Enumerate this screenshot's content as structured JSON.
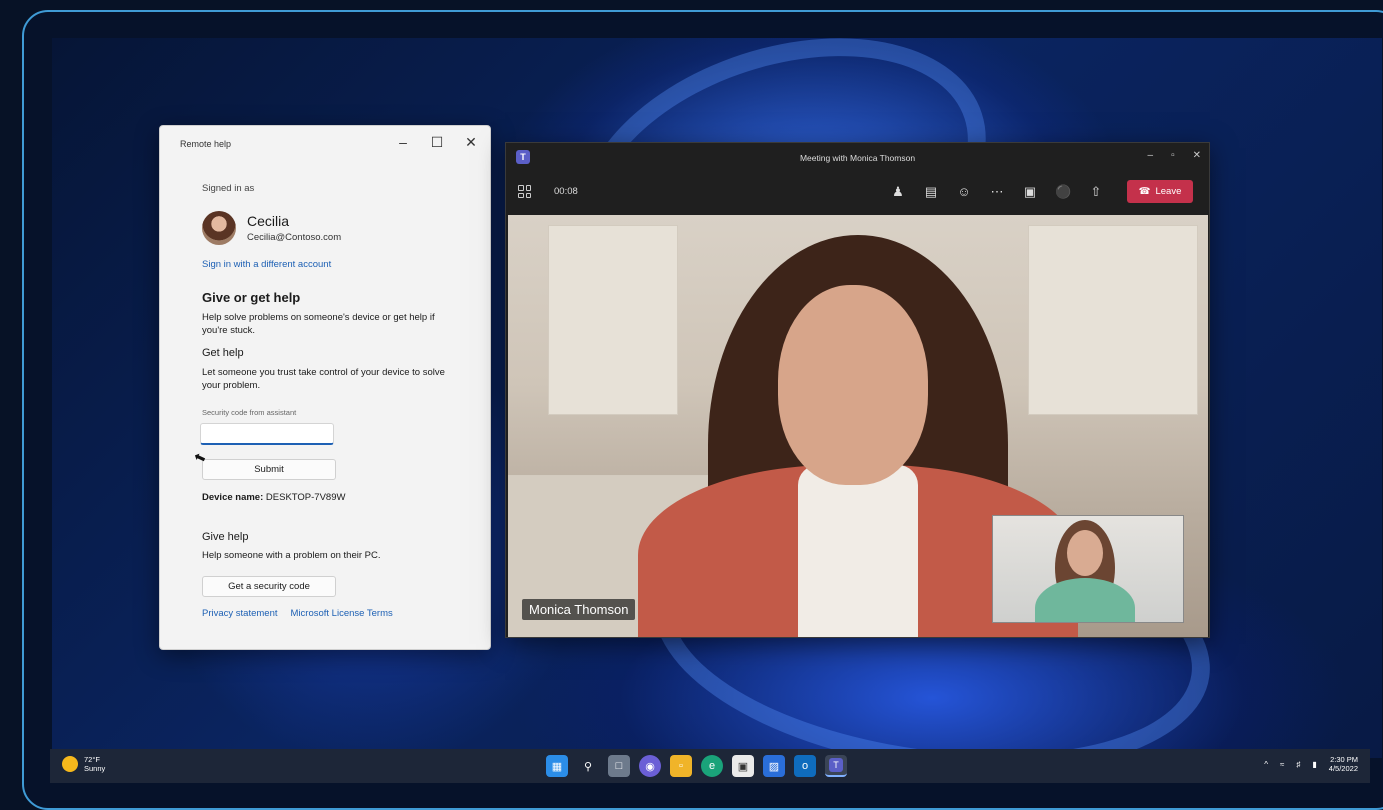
{
  "remote_help": {
    "title": "Remote help",
    "signed_in_label": "Signed in as",
    "user_name": "Cecilia",
    "user_email": "Cecilia@Contoso.com",
    "switch_account_link": "Sign in with a different account",
    "give_or_get_heading": "Give or get help",
    "give_or_get_desc": "Help solve problems on someone's device or get help if you're stuck.",
    "get_help_heading": "Get help",
    "get_help_desc": "Let someone you trust take control of your device to solve your problem.",
    "code_label": "Security code from assistant",
    "code_value": "",
    "submit_label": "Submit",
    "device_name_label": "Device name:",
    "device_name_value": "DESKTOP-7V89W",
    "give_help_heading": "Give help",
    "give_help_desc": "Help someone with a problem on their PC.",
    "get_code_label": "Get a security code",
    "privacy_link": "Privacy statement",
    "license_link": "Microsoft License Terms"
  },
  "teams": {
    "title": "Meeting with Monica Thomson",
    "timer": "00:08",
    "leave_label": "Leave",
    "participant_name": "Monica Thomson",
    "leave_color": "#c4314b"
  },
  "taskbar": {
    "temperature": "72°F",
    "condition": "Sunny",
    "time": "2:30 PM",
    "date": "4/5/2022"
  }
}
